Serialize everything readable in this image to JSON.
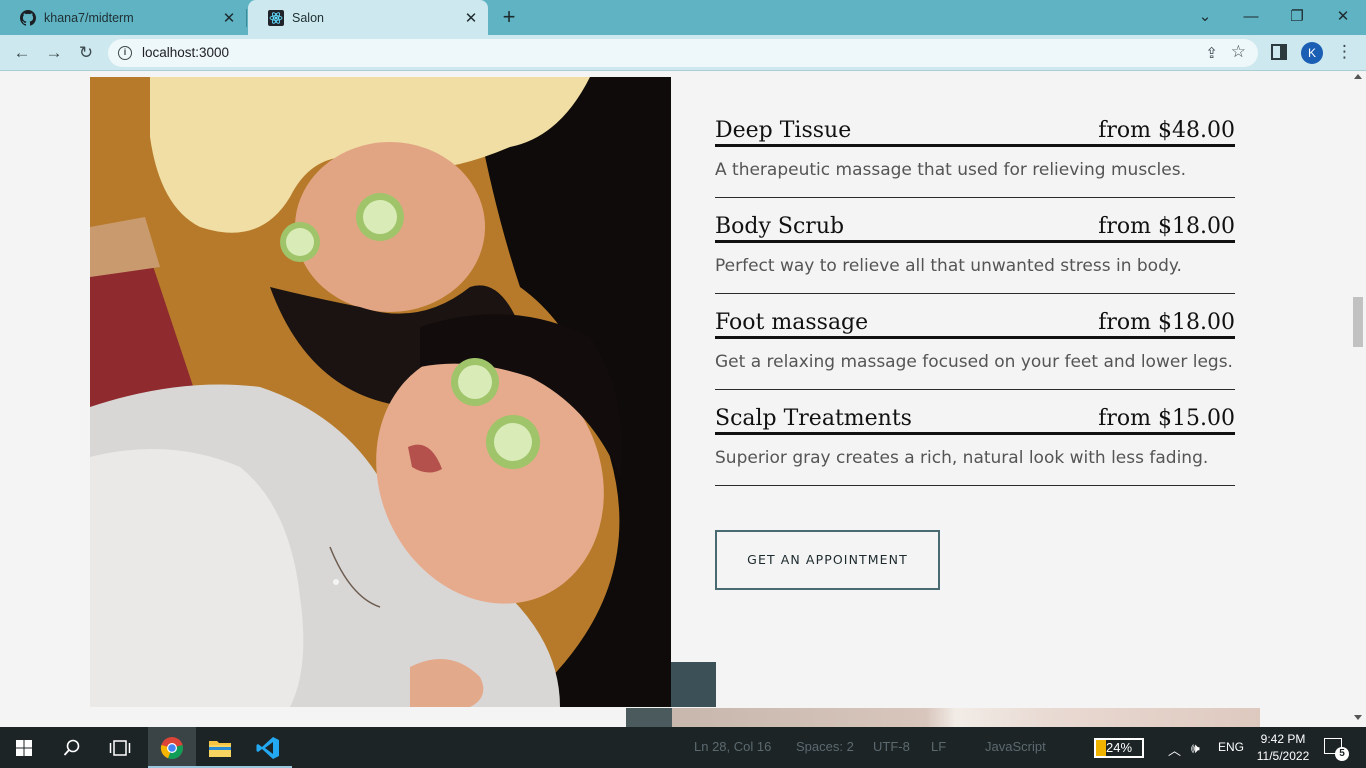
{
  "browser": {
    "tabs": [
      {
        "title": "khana7/midterm",
        "favicon": "github-icon"
      },
      {
        "title": "Salon",
        "favicon": "react-icon",
        "active": true
      }
    ],
    "url": "localhost:3000",
    "profile_initial": "K"
  },
  "services": [
    {
      "name": "Deep Tissue",
      "price": "from $48.00",
      "description": "A therapeutic massage that used for relieving muscles."
    },
    {
      "name": "Body Scrub",
      "price": "from $18.00",
      "description": "Perfect way to relieve all that unwanted stress in body."
    },
    {
      "name": "Foot massage",
      "price": "from $18.00",
      "description": "Get a relaxing massage focused on your feet and lower legs."
    },
    {
      "name": "Scalp Treatments",
      "price": "from $15.00",
      "description": "Superior gray creates a rich, natural look with less fading."
    }
  ],
  "cta_label": "GET AN APPOINTMENT",
  "taskbar": {
    "vscode_status": {
      "position": "Ln 28, Col 16",
      "spaces": "Spaces: 2",
      "encoding": "UTF-8",
      "eol": "LF",
      "language": "JavaScript"
    },
    "battery": "24%",
    "language": "ENG",
    "time": "9:42 PM",
    "date": "11/5/2022",
    "notifications": "5"
  },
  "colors": {
    "tab_strip": "#5fb3c2",
    "toolbar": "#cde8ee",
    "page_bg": "#f4f4f4",
    "cta_border": "#4a6a72",
    "accent_block": "#3c5157"
  }
}
